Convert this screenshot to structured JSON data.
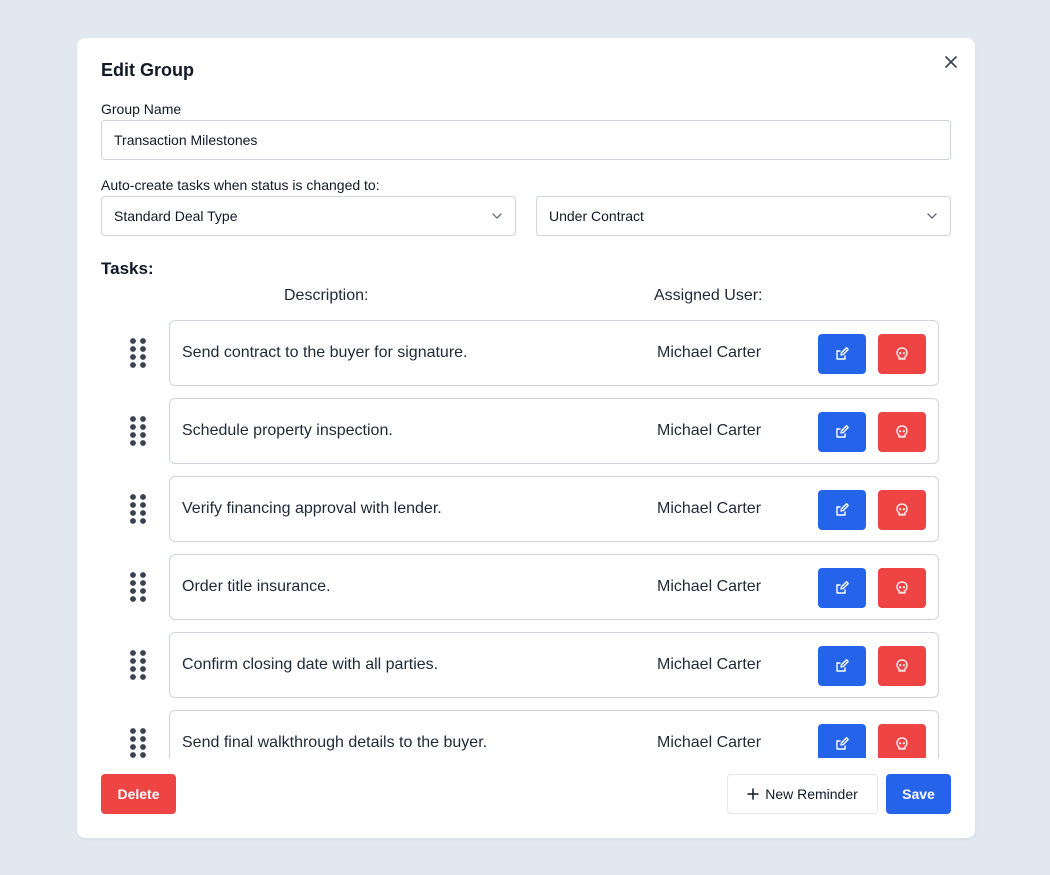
{
  "modal": {
    "title": "Edit Group",
    "close_icon": "close-icon"
  },
  "group_name": {
    "label": "Group Name",
    "value": "Transaction Milestones"
  },
  "auto_create": {
    "label": "Auto-create tasks when status is changed to:",
    "deal_type": "Standard Deal Type",
    "status": "Under Contract"
  },
  "tasks": {
    "heading": "Tasks:",
    "col_description": "Description:",
    "col_assigned": "Assigned User:",
    "items": [
      {
        "description": "Send contract to the buyer for signature.",
        "assigned_user": "Michael Carter"
      },
      {
        "description": "Schedule property inspection.",
        "assigned_user": "Michael Carter"
      },
      {
        "description": "Verify financing approval with lender.",
        "assigned_user": "Michael Carter"
      },
      {
        "description": "Order title insurance.",
        "assigned_user": "Michael Carter"
      },
      {
        "description": "Confirm closing date with all parties.",
        "assigned_user": "Michael Carter"
      },
      {
        "description": "Send final walkthrough details to the buyer.",
        "assigned_user": "Michael Carter"
      }
    ]
  },
  "footer": {
    "delete_label": "Delete",
    "new_reminder_label": "New Reminder",
    "save_label": "Save"
  },
  "icons": {
    "edit": "pencil-square-icon",
    "remove": "skull-icon",
    "drag": "grip-vertical-icon",
    "dropdown": "chevron-down-icon",
    "add": "plus-icon"
  },
  "colors": {
    "primary": "#2563eb",
    "danger": "#ef4444",
    "backdrop": "#e2e8f0"
  }
}
